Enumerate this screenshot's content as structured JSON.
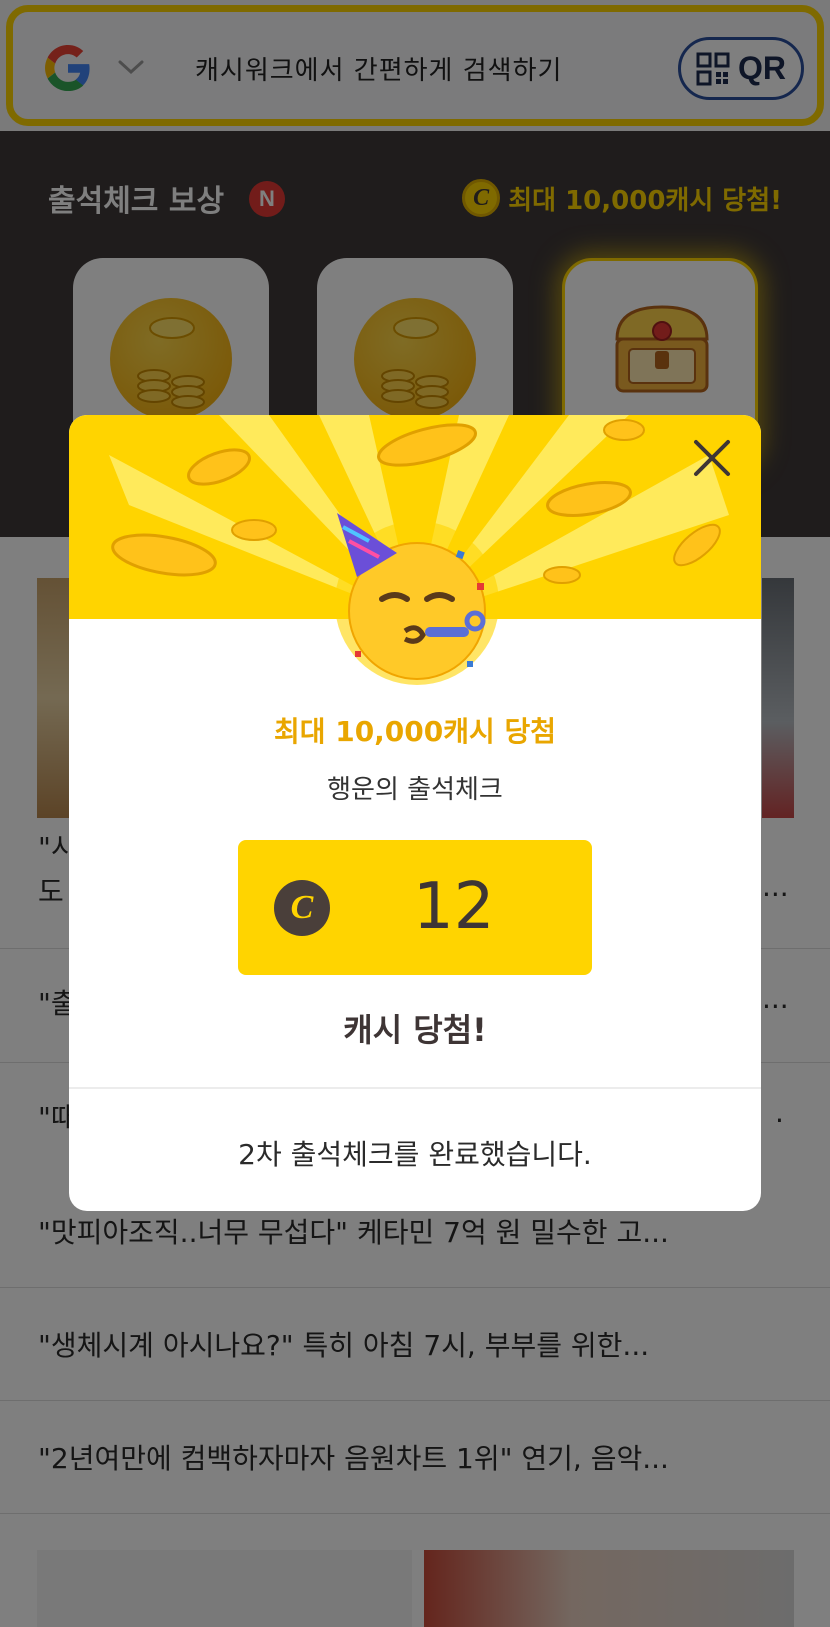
{
  "search": {
    "placeholder": "캐시워크에서 간편하게 검색하기",
    "qr_label": "QR"
  },
  "attendance": {
    "title": "출석체크 보상",
    "badge": "N",
    "promo_coin": "C",
    "promo_text": "최대 10,000캐시 당첨!"
  },
  "feed": {
    "rows": [
      {
        "text": "\"맛피아조직..너무 무섭다\" 케타민 7억 원 밀수한 고..."
      },
      {
        "text": "\"생체시계 아시나요?\" 특히 아침 7시, 부부를 위한..."
      },
      {
        "text": "\"2년여만에 컴백하자마자 음원차트 1위\" 연기, 음악..."
      }
    ],
    "hidden_fragments": [
      "\"시",
      "도",
      "...",
      "\"출",
      "...",
      "\"때",
      "."
    ]
  },
  "modal": {
    "subhead": "최대 10,000캐시 당첨",
    "title": "행운의 출석체크",
    "coin_symbol": "C",
    "amount": "12",
    "reward_label": "캐시 당첨!",
    "footer": "2차 출석체크를 완료했습니다."
  },
  "colors": {
    "brand_yellow": "#ffd400",
    "dark_band": "#3e3838",
    "subhead_gold": "#e9a600",
    "badge_red": "#e53935",
    "qr_blue": "#2a4f9c"
  },
  "icons": [
    "google-logo-icon",
    "chevron-down-icon",
    "qr-code-icon",
    "coin-icon",
    "treasure-chest-icon",
    "close-icon",
    "party-face-emoji-icon"
  ]
}
